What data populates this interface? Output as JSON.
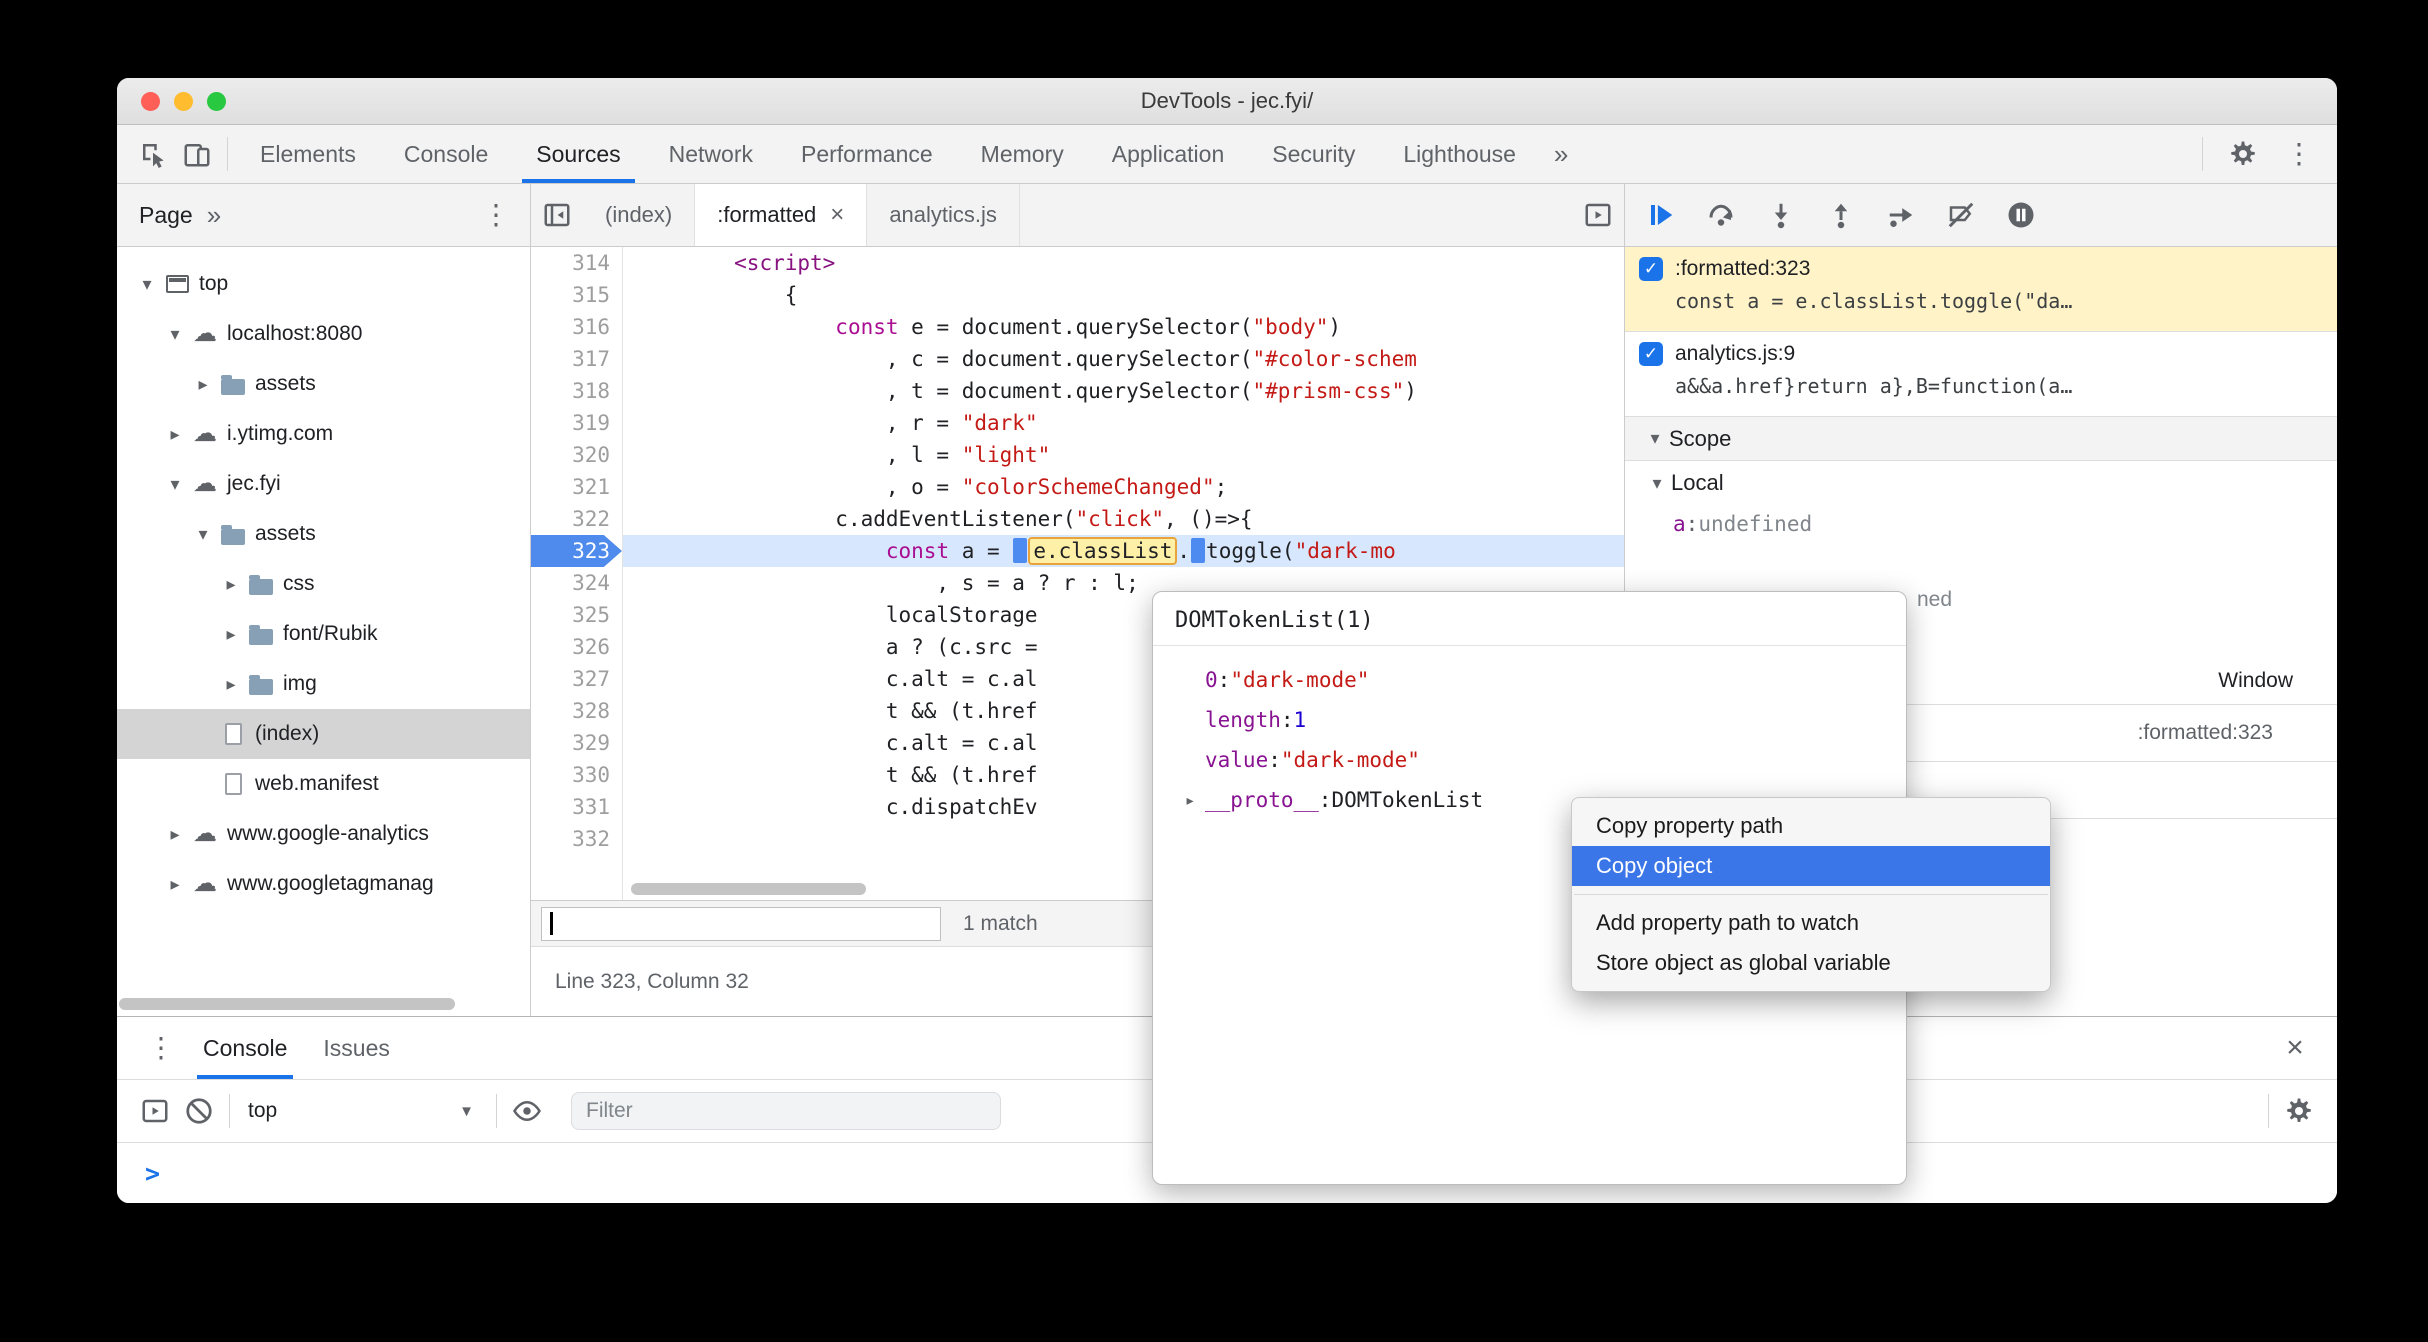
{
  "colors": {
    "accent": "#1a73e8",
    "exec-line-bg": "#d7e7fd",
    "breakpoint-flag": "#4e8bec",
    "keyword": "#aa0d91",
    "string": "#c41a16",
    "number": "#1c00cf",
    "property": "#881391",
    "tag": "#881280",
    "menu-highlight": "#3b76e8",
    "breakpoint-selected-bg": "#fff3c7"
  },
  "icons": {
    "kebab": "⋮",
    "close": "×",
    "dropdown-arrow": "▼",
    "expand-open": "▾",
    "expand-closed": "▸",
    "cloud": "☁",
    "check": "✓"
  },
  "titlebar": {
    "title": "DevTools - jec.fyi/"
  },
  "toolbar": {
    "tabs": [
      "Elements",
      "Console",
      "Sources",
      "Network",
      "Performance",
      "Memory",
      "Application",
      "Security",
      "Lighthouse"
    ],
    "active_tab": "Sources",
    "overflow_label": "»"
  },
  "navigator": {
    "tab_label": "Page",
    "overflow_label": "»",
    "tree": [
      {
        "label": "top",
        "icon": "frame",
        "arrow": "open",
        "level": 0
      },
      {
        "label": "localhost:8080",
        "icon": "cloud",
        "arrow": "open",
        "level": 1
      },
      {
        "label": "assets",
        "icon": "folder",
        "arrow": "closed",
        "level": 2
      },
      {
        "label": "i.ytimg.com",
        "icon": "cloud",
        "arrow": "closed",
        "level": 1
      },
      {
        "label": "jec.fyi",
        "icon": "cloud",
        "arrow": "open",
        "level": 1
      },
      {
        "label": "assets",
        "icon": "folder",
        "arrow": "open",
        "level": 2
      },
      {
        "label": "css",
        "icon": "folder",
        "arrow": "closed",
        "level": 3
      },
      {
        "label": "font/Rubik",
        "icon": "folder",
        "arrow": "closed",
        "level": 3
      },
      {
        "label": "img",
        "icon": "folder",
        "arrow": "closed",
        "level": 3
      },
      {
        "label": "(index)",
        "icon": "file",
        "arrow": "none",
        "level": 2,
        "selected": true
      },
      {
        "label": "web.manifest",
        "icon": "file",
        "arrow": "none",
        "level": 2
      },
      {
        "label": "www.google-analytics",
        "icon": "cloud",
        "arrow": "closed",
        "level": 1
      },
      {
        "label": "www.googletagmanag",
        "icon": "cloud",
        "arrow": "closed",
        "level": 1
      }
    ]
  },
  "editor": {
    "tabs": [
      "(index)",
      ":formatted",
      "analytics.js"
    ],
    "active_tab": ":formatted",
    "exec_line": 323,
    "search_match_label": "1 match",
    "status_label": "Line 323, Column 32",
    "lines": [
      {
        "n": 314,
        "tokens": [
          [
            "        ",
            ""
          ],
          [
            "<script>",
            "tag"
          ]
        ]
      },
      {
        "n": 315,
        "tokens": [
          [
            "            {",
            ""
          ]
        ]
      },
      {
        "n": 316,
        "tokens": [
          [
            "                ",
            ""
          ],
          [
            "const",
            "kw"
          ],
          [
            " e = document.querySelector(",
            ""
          ],
          [
            "\"body\"",
            "str"
          ],
          [
            ")",
            ""
          ]
        ]
      },
      {
        "n": 317,
        "tokens": [
          [
            "                    , c = document.querySelector(",
            ""
          ],
          [
            "\"#color-schem",
            "str"
          ]
        ]
      },
      {
        "n": 318,
        "tokens": [
          [
            "                    , t = document.querySelector(",
            ""
          ],
          [
            "\"#prism-css\"",
            "str"
          ],
          [
            ")",
            ""
          ]
        ]
      },
      {
        "n": 319,
        "tokens": [
          [
            "                    , r = ",
            ""
          ],
          [
            "\"dark\"",
            "str"
          ]
        ]
      },
      {
        "n": 320,
        "tokens": [
          [
            "                    , l = ",
            ""
          ],
          [
            "\"light\"",
            "str"
          ]
        ]
      },
      {
        "n": 321,
        "tokens": [
          [
            "                    , o = ",
            ""
          ],
          [
            "\"colorSchemeChanged\"",
            "str"
          ],
          [
            ";",
            ""
          ]
        ]
      },
      {
        "n": 322,
        "tokens": [
          [
            "                ",
            ""
          ],
          [
            "c.addEventListener(",
            ""
          ],
          [
            "\"click\"",
            "str"
          ],
          [
            ", ()=>{",
            ""
          ]
        ]
      },
      {
        "n": 323,
        "tokens": [
          [
            "                    ",
            ""
          ],
          [
            "const",
            "kw"
          ],
          [
            " a = ",
            ""
          ],
          [
            "",
            "mark"
          ],
          [
            "e.classList",
            "eval"
          ],
          [
            ".",
            ""
          ],
          [
            "",
            "mark"
          ],
          [
            "toggle(",
            ""
          ],
          [
            "\"dark-mo",
            "str"
          ]
        ]
      },
      {
        "n": 324,
        "tokens": [
          [
            "                        , s = a ? r : l;",
            ""
          ]
        ]
      },
      {
        "n": 325,
        "tokens": [
          [
            "                    localStorage",
            ""
          ]
        ]
      },
      {
        "n": 326,
        "tokens": [
          [
            "                    a ? (c.src =",
            ""
          ]
        ]
      },
      {
        "n": 327,
        "tokens": [
          [
            "                    c.alt = c.al",
            ""
          ]
        ]
      },
      {
        "n": 328,
        "tokens": [
          [
            "                    t && (t.href",
            ""
          ]
        ]
      },
      {
        "n": 329,
        "tokens": [
          [
            "                    c.alt = c.al",
            ""
          ]
        ]
      },
      {
        "n": 330,
        "tokens": [
          [
            "                    t && (t.href",
            ""
          ]
        ]
      },
      {
        "n": 331,
        "tokens": [
          [
            "                    c.dispatchEv",
            ""
          ]
        ]
      },
      {
        "n": 332,
        "tokens": [
          [
            "",
            ""
          ]
        ]
      }
    ]
  },
  "debugger": {
    "control_icons": [
      "resume",
      "step-over",
      "step-into",
      "step-out",
      "step",
      "deactivate-breakpoints",
      "pause-on-exceptions"
    ],
    "breakpoints": [
      {
        "location": ":formatted:323",
        "preview": "const a = e.classList.toggle(\"da…",
        "checked": true
      },
      {
        "location": "analytics.js:9",
        "preview": "a&&a.href}return a},B=function(a…",
        "checked": true
      }
    ],
    "scope_label": "Scope",
    "local_label": "Local",
    "variable": {
      "name": "a",
      "value": "undefined"
    },
    "covered_fragment": "ned",
    "global_value": "Window",
    "callstack_location": ":formatted:323"
  },
  "popup": {
    "title": "DOMTokenList(1)",
    "properties": [
      {
        "key": "0",
        "value": "\"dark-mode\"",
        "vtype": "string"
      },
      {
        "key": "length",
        "value": "1",
        "vtype": "number"
      },
      {
        "key": "value",
        "value": "\"dark-mode\"",
        "vtype": "string"
      },
      {
        "key": "__proto__",
        "value": "DOMTokenList",
        "vtype": "object"
      }
    ]
  },
  "context_menu": {
    "items": [
      "Copy property path",
      "Copy object",
      "Add property path to watch",
      "Store object as global variable"
    ],
    "highlighted_item": "Copy object"
  },
  "console": {
    "tabs": [
      "Console",
      "Issues"
    ],
    "active_tab": "Console",
    "context_label": "top",
    "filter_placeholder": "Filter",
    "prompt_glyph": ">"
  }
}
